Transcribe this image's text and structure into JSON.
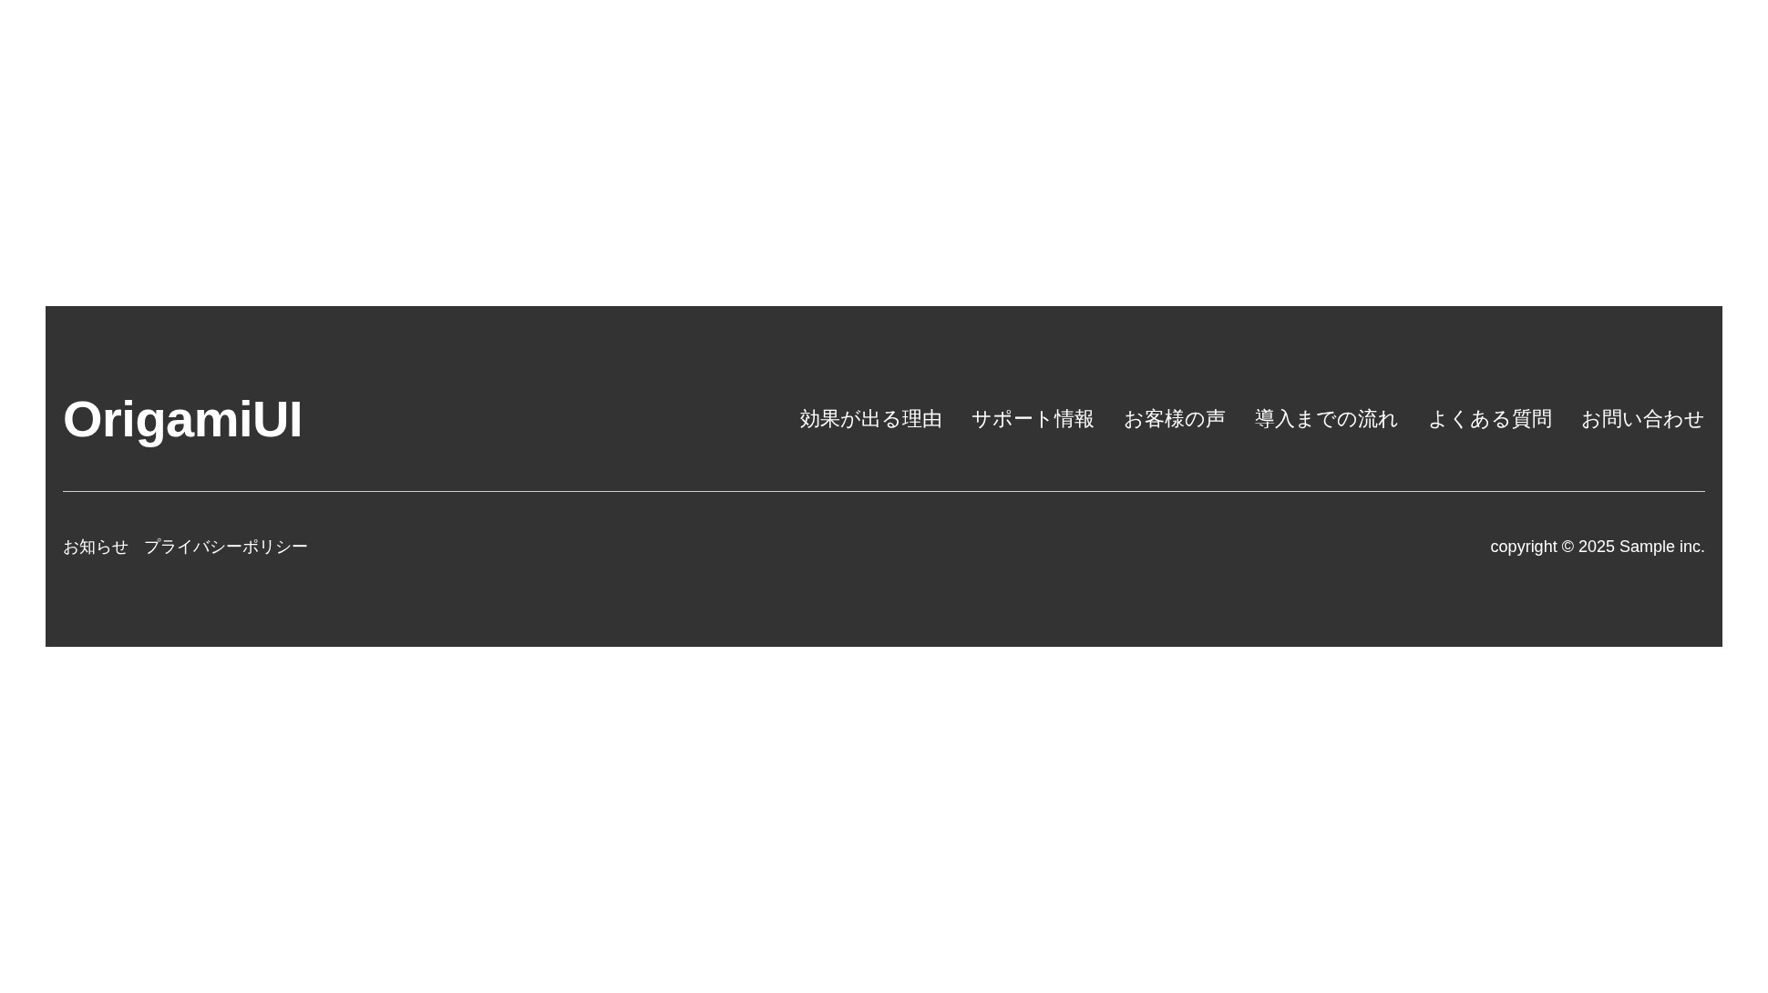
{
  "footer": {
    "logo": "OrigamiUI",
    "nav_links": [
      "効果が出る理由",
      "サポート情報",
      "お客様の声",
      "導入までの流れ",
      "よくある質問",
      "お問い合わせ"
    ],
    "bottom_links": [
      "お知らせ",
      "プライバシーポリシー"
    ],
    "copyright": "copyright © 2025 Sample inc."
  }
}
